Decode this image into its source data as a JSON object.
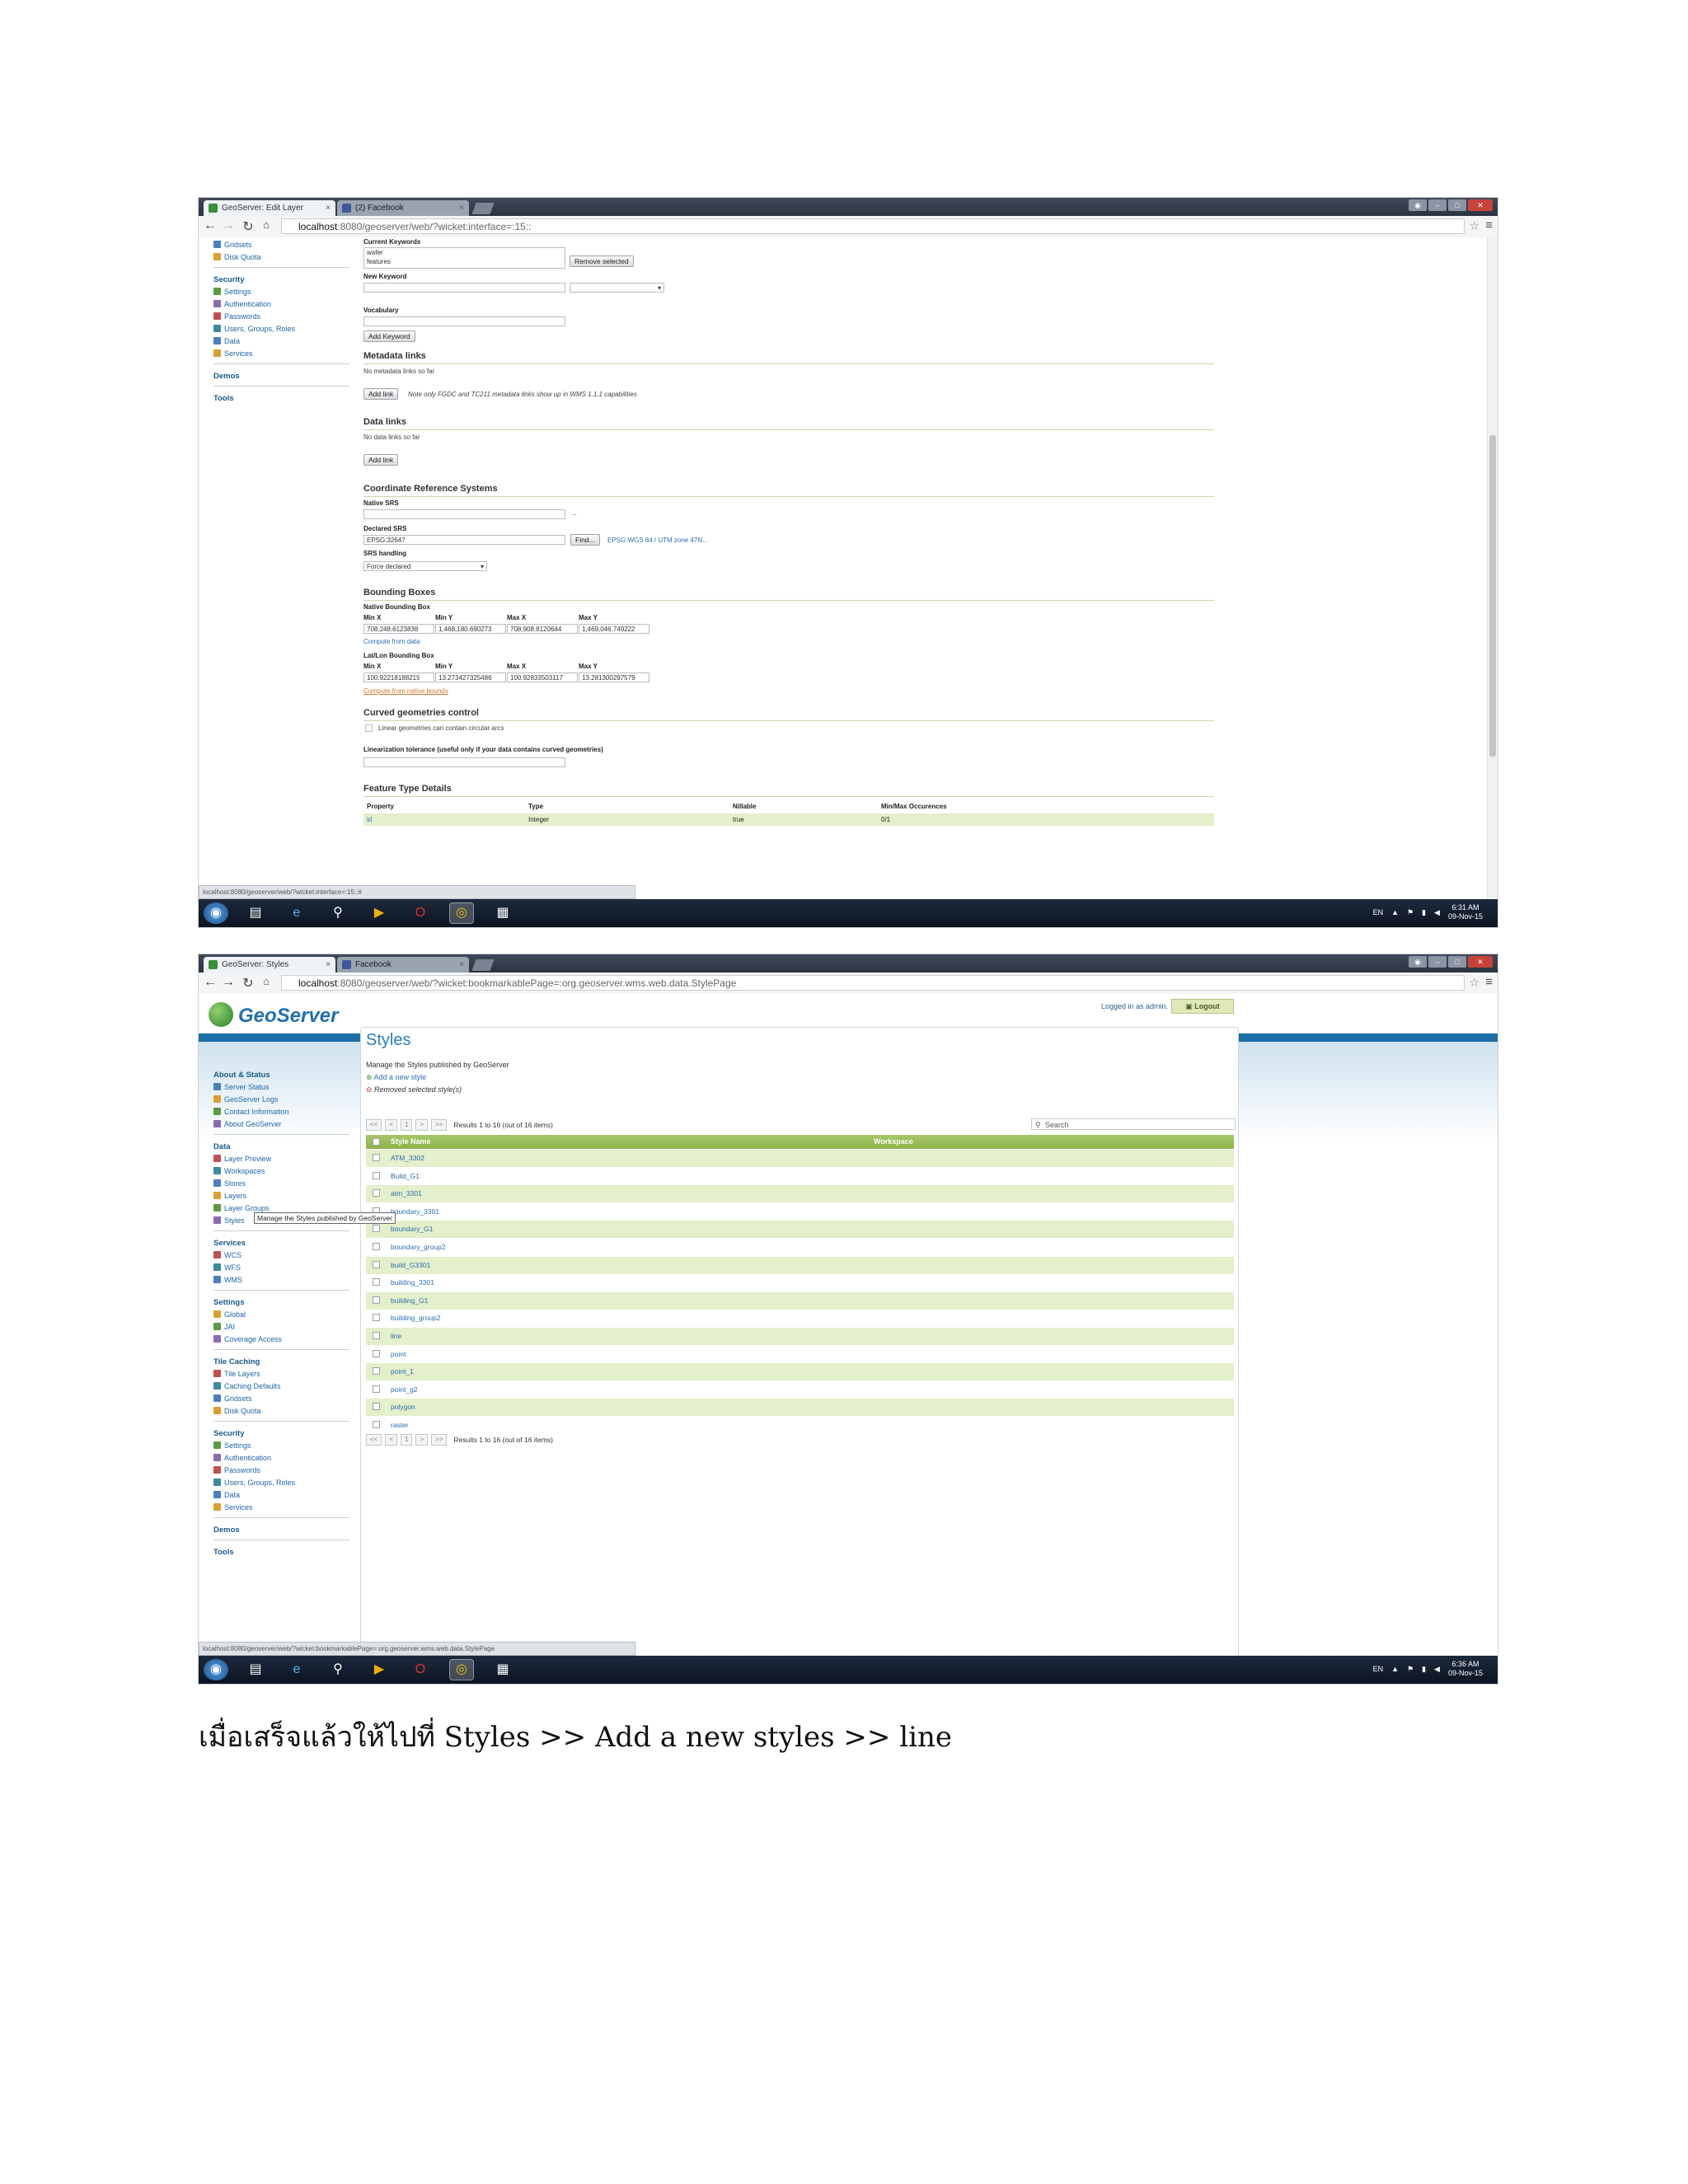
{
  "shot1": {
    "tabs": [
      {
        "label": "GeoServer: Edit Layer"
      },
      {
        "label": "(2) Facebook"
      }
    ],
    "address": {
      "host": "localhost",
      "path": ":8080/geoserver/web/?wicket:interface=:15::"
    },
    "leftnav": [
      {
        "type": "item",
        "label": "Gridsets"
      },
      {
        "type": "item",
        "label": "Disk Quota"
      },
      {
        "type": "section",
        "label": "Security"
      },
      {
        "type": "item",
        "label": "Settings"
      },
      {
        "type": "item",
        "label": "Authentication"
      },
      {
        "type": "item",
        "label": "Passwords"
      },
      {
        "type": "item",
        "label": "Users, Groups, Roles"
      },
      {
        "type": "item",
        "label": "Data"
      },
      {
        "type": "item",
        "label": "Services"
      },
      {
        "type": "section",
        "label": "Demos"
      },
      {
        "type": "section",
        "label": "Tools"
      }
    ],
    "form": {
      "current_keywords_label": "Current Keywords",
      "keywords": [
        "wafer",
        "features"
      ],
      "remove_selected": "Remove selected",
      "new_keyword_label": "New Keyword",
      "vocabulary_label": "Vocabulary",
      "add_keyword": "Add Keyword",
      "metadata_links_title": "Metadata links",
      "no_metadata": "No metadata links so far",
      "add_link": "Add link",
      "metadata_note": "Note only FGDC and TC211 metadata links show up in WMS 1.1.1 capabilities",
      "data_links_title": "Data links",
      "no_data_links": "No data links so far",
      "crs_title": "Coordinate Reference Systems",
      "native_srs_label": "Native SRS",
      "native_srs_extra": "...",
      "declared_srs_label": "Declared SRS",
      "declared_srs_value": "EPSG:32647",
      "find": "Find...",
      "declared_srs_link": "EPSG:WGS 84 / UTM zone 47N...",
      "srs_handling_label": "SRS handling",
      "srs_handling_value": "Force declared",
      "bbox_title": "Bounding Boxes",
      "native_bbox_label": "Native Bounding Box",
      "bbox_cols": [
        "Min X",
        "Min Y",
        "Max X",
        "Max Y"
      ],
      "native_bbox_values": [
        "708,248.6123838",
        "1,468,180.690273",
        "708,908.8120644",
        "1,469,046.749222"
      ],
      "compute_from_data": "Compute from data",
      "latlon_bbox_label": "Lat/Lon Bounding Box",
      "latlon_bbox_values": [
        "100.92218188215",
        "13.273427325486",
        "100.92833503117",
        "13.281300297579"
      ],
      "compute_from_native": "Compute from native bounds",
      "curved_title": "Curved geometries control",
      "curved_checkbox": "Linear geometries can contain circular arcs",
      "linearization_label": "Linearization tolerance (useful only if your data contains curved geometries)",
      "ftd_title": "Feature Type Details",
      "ftd_cols": [
        "Property",
        "Type",
        "Nillable",
        "Min/Max Occurences"
      ],
      "ftd_rows": [
        [
          "id",
          "Integer",
          "true",
          "0/1"
        ]
      ]
    },
    "statusurl": "localhost:8080/geoserver/web/?wicket:interface=:15::#",
    "clock": {
      "time": "6:31 AM",
      "date": "09-Nov-15"
    },
    "lang": "EN"
  },
  "shot2": {
    "tabs": [
      {
        "label": "GeoServer: Styles"
      },
      {
        "label": "Facebook"
      }
    ],
    "address": {
      "host": "localhost",
      "path": ":8080/geoserver/web/?wicket:bookmarkablePage=:org.geoserver.wms.web.data.StylePage"
    },
    "logo": "GeoServer",
    "logged_in": "Logged in as admin.",
    "logout": "Logout",
    "leftnav": [
      {
        "type": "section",
        "label": "About & Status"
      },
      {
        "type": "item",
        "label": "Server Status"
      },
      {
        "type": "item",
        "label": "GeoServer Logs"
      },
      {
        "type": "item",
        "label": "Contact Information"
      },
      {
        "type": "item",
        "label": "About GeoServer"
      },
      {
        "type": "section",
        "label": "Data"
      },
      {
        "type": "item",
        "label": "Layer Preview"
      },
      {
        "type": "item",
        "label": "Workspaces"
      },
      {
        "type": "item",
        "label": "Stores"
      },
      {
        "type": "item",
        "label": "Layers"
      },
      {
        "type": "item",
        "label": "Layer Groups"
      },
      {
        "type": "item",
        "label": "Styles"
      },
      {
        "type": "section",
        "label": "Services"
      },
      {
        "type": "item",
        "label": "WCS"
      },
      {
        "type": "item",
        "label": "WFS"
      },
      {
        "type": "item",
        "label": "WMS"
      },
      {
        "type": "section",
        "label": "Settings"
      },
      {
        "type": "item",
        "label": "Global"
      },
      {
        "type": "item",
        "label": "JAI"
      },
      {
        "type": "item",
        "label": "Coverage Access"
      },
      {
        "type": "section",
        "label": "Tile Caching"
      },
      {
        "type": "item",
        "label": "Tile Layers"
      },
      {
        "type": "item",
        "label": "Caching Defaults"
      },
      {
        "type": "item",
        "label": "Gridsets"
      },
      {
        "type": "item",
        "label": "Disk Quota"
      },
      {
        "type": "section",
        "label": "Security"
      },
      {
        "type": "item",
        "label": "Settings"
      },
      {
        "type": "item",
        "label": "Authentication"
      },
      {
        "type": "item",
        "label": "Passwords"
      },
      {
        "type": "item",
        "label": "Users, Groups, Roles"
      },
      {
        "type": "item",
        "label": "Data"
      },
      {
        "type": "item",
        "label": "Services"
      },
      {
        "type": "section",
        "label": "Demos"
      },
      {
        "type": "section",
        "label": "Tools"
      }
    ],
    "tooltip": "Manage the Styles published by GeoServer",
    "page_title": "Styles",
    "page_desc": "Manage the Styles published by GeoServer",
    "add_style": "Add a new style",
    "remove_style": "Removed selected style(s)",
    "pager": {
      "buttons": [
        "<<",
        "<",
        "1",
        ">",
        ">>"
      ],
      "results": "Results 1 to 16 (out of 16 items)"
    },
    "search_placeholder": "Search",
    "columns": [
      "Style Name",
      "Workspace"
    ],
    "styles": [
      "ATM_3302",
      "Build_G1",
      "atm_3301",
      "boundary_3301",
      "boundary_G1",
      "boundary_group2",
      "build_G3301",
      "building_3301",
      "building_G1",
      "building_group2",
      "line",
      "point",
      "point_1",
      "point_g2",
      "polygon",
      "raster"
    ],
    "statusurl": "localhost:8080/geoserver/web/?wicket:bookmarkablePage=:org.geoserver.wms.web.data.StylePage",
    "clock": {
      "time": "6:36 AM",
      "date": "09-Nov-15"
    },
    "lang": "EN"
  },
  "caption": "เมื่อเสร็จแล้วให้ไปที่ Styles >> Add a new styles >> line",
  "colors": {
    "accent": "#1b6ea6",
    "table_header": "#8cb14a",
    "row_alt": "#e4efcb",
    "link": "#2a6db0"
  }
}
